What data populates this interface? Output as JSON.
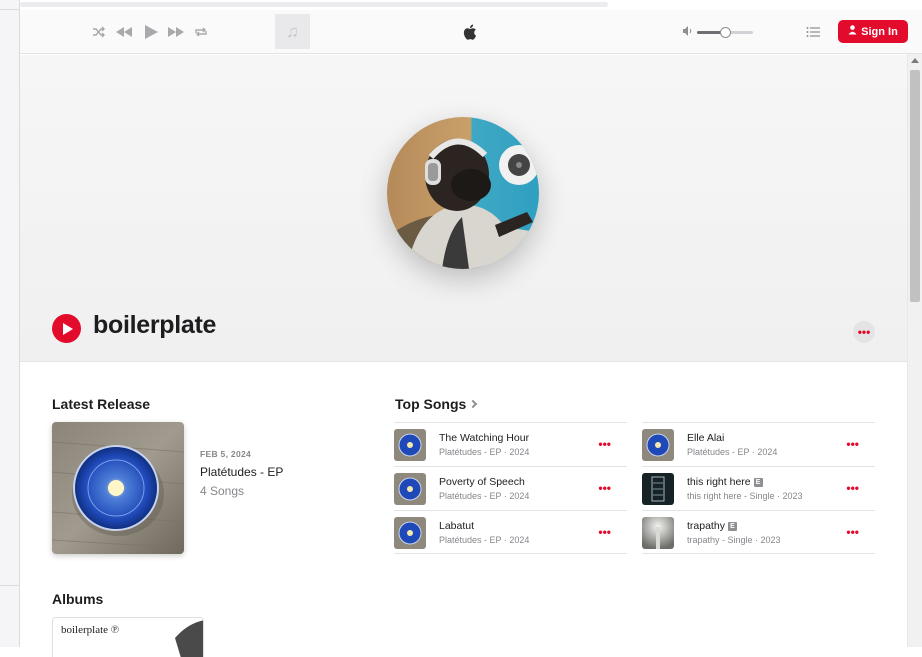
{
  "player": {
    "controls": [
      "shuffle-icon",
      "previous-icon",
      "play-icon",
      "next-icon",
      "repeat-icon"
    ],
    "now_playing_icon": "♫",
    "volume_level": 0.5,
    "signin_label": "Sign In",
    "accent_color": "#e30b2c"
  },
  "artist": {
    "name": "boilerplate",
    "more_label": "•••"
  },
  "latest_release": {
    "section_title": "Latest Release",
    "date": "FEB 5, 2024",
    "title": "Platétudes - EP",
    "count": "4 Songs"
  },
  "top_songs": {
    "section_title": "Top Songs",
    "columns": [
      [
        {
          "title": "The Watching Hour",
          "sub": "Platétudes - EP · 2024",
          "explicit": false,
          "art": "orb"
        },
        {
          "title": "Poverty of Speech",
          "sub": "Platétudes - EP · 2024",
          "explicit": false,
          "art": "orb"
        },
        {
          "title": "Labatut",
          "sub": "Platétudes - EP · 2024",
          "explicit": false,
          "art": "orb"
        }
      ],
      [
        {
          "title": "Elle Alai",
          "sub": "Platétudes - EP · 2024",
          "explicit": false,
          "art": "orb"
        },
        {
          "title": "this right here",
          "sub": "this right here - Single · 2023",
          "explicit": true,
          "art": "dark"
        },
        {
          "title": "trapathy",
          "sub": "trapathy - Single · 2023",
          "explicit": true,
          "art": "light"
        }
      ]
    ],
    "explicit_label": "E",
    "more_label": "•••"
  },
  "albums": {
    "section_title": "Albums",
    "first_card_label": "boilerplate ℗"
  }
}
